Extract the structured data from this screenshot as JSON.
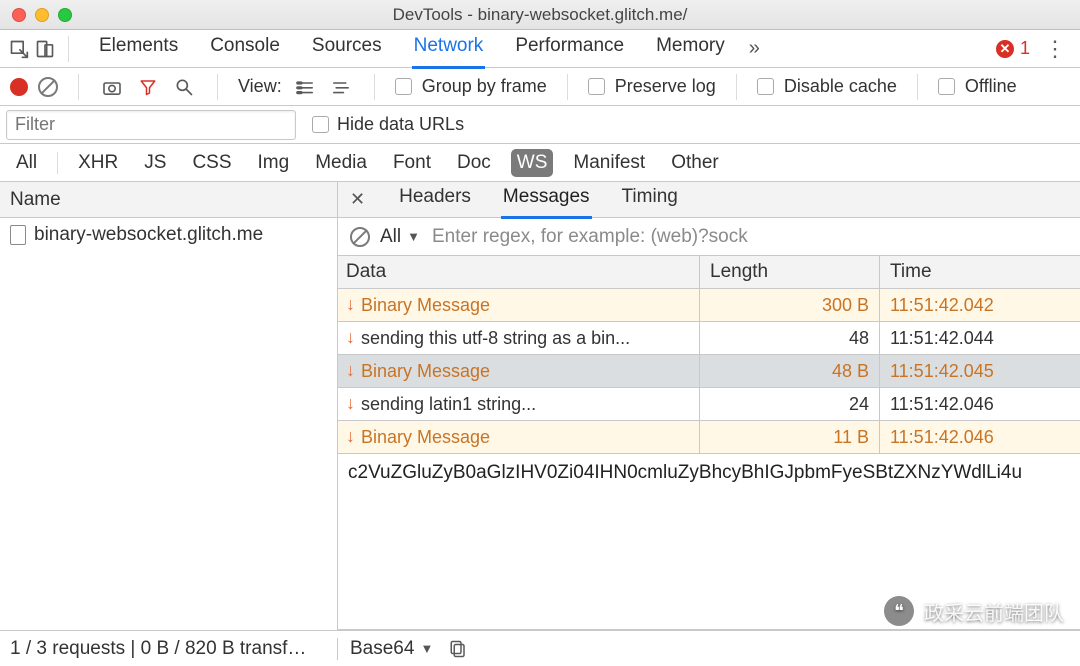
{
  "window": {
    "title": "DevTools - binary-websocket.glitch.me/"
  },
  "topTabs": {
    "items": [
      "Elements",
      "Console",
      "Sources",
      "Network",
      "Performance",
      "Memory"
    ],
    "activeIndex": 3,
    "overflow": "»",
    "errorCount": "1"
  },
  "toolbar": {
    "viewLabel": "View:",
    "groupByFrame": "Group by frame",
    "preserveLog": "Preserve log",
    "disableCache": "Disable cache",
    "offline": "Offline"
  },
  "filterRow": {
    "placeholder": "Filter",
    "hideDataURLs": "Hide data URLs"
  },
  "types": {
    "items": [
      "All",
      "XHR",
      "JS",
      "CSS",
      "Img",
      "Media",
      "Font",
      "Doc",
      "WS",
      "Manifest",
      "Other"
    ],
    "activeIndex": 8
  },
  "requests": {
    "header": "Name",
    "rows": [
      {
        "name": "binary-websocket.glitch.me"
      }
    ]
  },
  "detail": {
    "tabs": [
      "Headers",
      "Messages",
      "Timing"
    ],
    "activeIndex": 1,
    "filter": {
      "all": "All",
      "placeholder": "Enter regex, for example: (web)?sock"
    }
  },
  "messages": {
    "columns": {
      "data": "Data",
      "length": "Length",
      "time": "Time"
    },
    "rows": [
      {
        "dir": "down",
        "binary": true,
        "text": "Binary Message",
        "length": "300 B",
        "time": "11:51:42.042",
        "sel": false
      },
      {
        "dir": "down",
        "binary": false,
        "text": "sending this utf-8 string as a bin...",
        "length": "48",
        "time": "11:51:42.044",
        "sel": false
      },
      {
        "dir": "down",
        "binary": true,
        "text": "Binary Message",
        "length": "48 B",
        "time": "11:51:42.045",
        "sel": true
      },
      {
        "dir": "down",
        "binary": false,
        "text": "sending latin1 string...",
        "length": "24",
        "time": "11:51:42.046",
        "sel": false
      },
      {
        "dir": "down",
        "binary": true,
        "text": "Binary Message",
        "length": "11 B",
        "time": "11:51:42.046",
        "sel": false
      }
    ],
    "preview": "c2VuZGluZyB0aGlzIHV0Zi04IHN0cmluZyBhcyBhIGJpbmFyeSBtZXNzYWdlLi4u"
  },
  "status": {
    "left": "1 / 3 requests | 0 B / 820 B transf…",
    "encoding": "Base64"
  },
  "watermark": {
    "text": "政采云前端团队"
  }
}
